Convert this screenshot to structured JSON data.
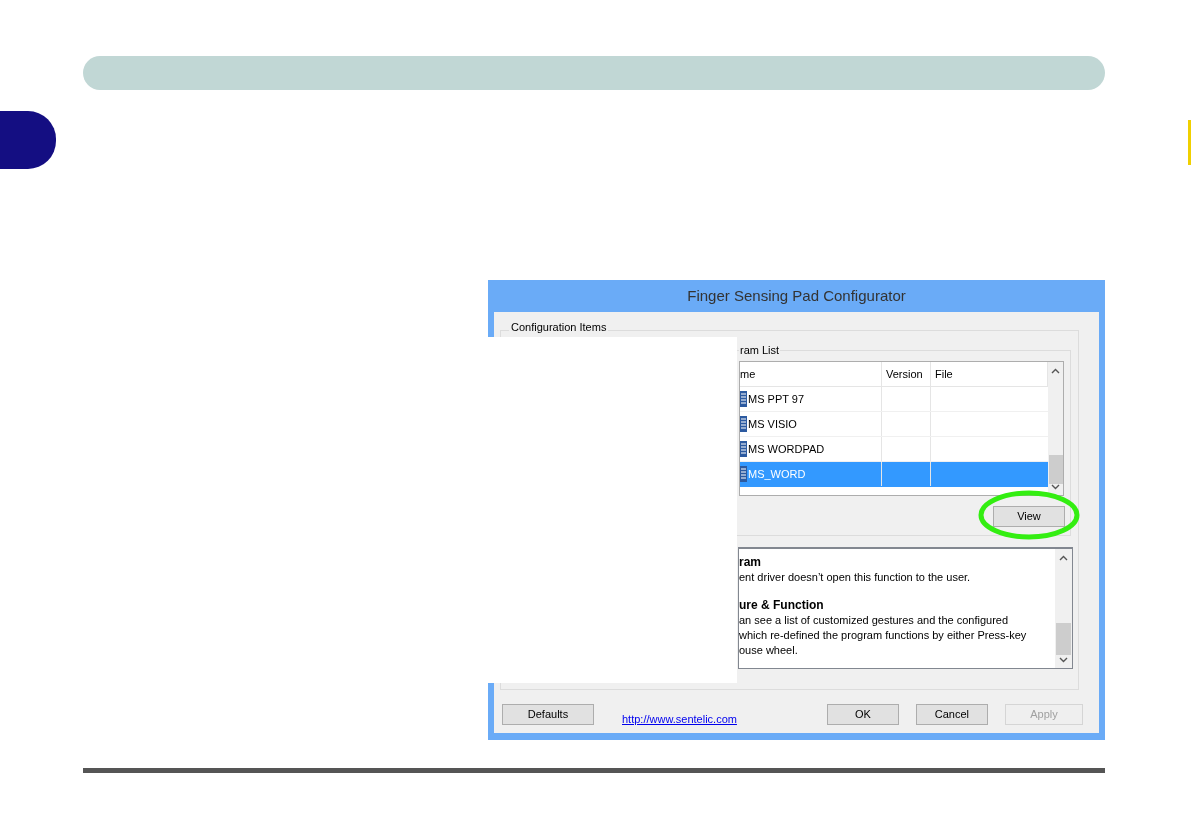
{
  "window": {
    "title": "Finger Sensing Pad Configurator"
  },
  "config_group": {
    "legend": "Configuration Items"
  },
  "program_list": {
    "legend": "ram List",
    "columns": [
      "me",
      "Version",
      "File"
    ],
    "rows": [
      {
        "name": "MS PPT 97",
        "selected": false
      },
      {
        "name": "MS VISIO",
        "selected": false
      },
      {
        "name": "MS WORDPAD",
        "selected": false
      },
      {
        "name": "MS_WORD",
        "selected": true
      }
    ],
    "view_button": "View"
  },
  "description": [
    {
      "kind": "heading",
      "text": "ram"
    },
    {
      "kind": "line",
      "text": "ent driver doesn’t open this function to the user."
    },
    {
      "kind": "gap"
    },
    {
      "kind": "heading",
      "text": "ure & Function"
    },
    {
      "kind": "line",
      "text": "an see a list of customized gestures and the configured"
    },
    {
      "kind": "line",
      "text": "which re-defined the program functions by either Press-key"
    },
    {
      "kind": "line",
      "text": "ouse wheel."
    }
  ],
  "footer": {
    "defaults": "Defaults",
    "link": "http://www.sentelic.com",
    "buttons": [
      {
        "label": "OK",
        "disabled": false
      },
      {
        "label": "Cancel",
        "disabled": false
      },
      {
        "label": "Apply",
        "disabled": true
      }
    ]
  }
}
